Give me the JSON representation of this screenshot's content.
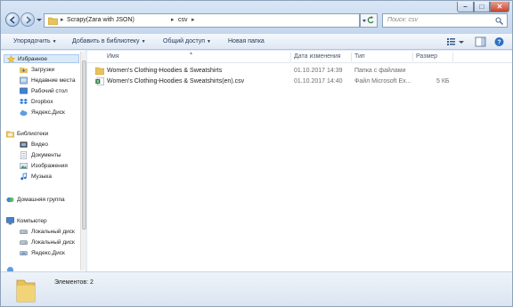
{
  "address": {
    "crumbs": [
      "Scrapy(Zara with JSON)",
      "csv"
    ],
    "search_placeholder": "Поиск: csv"
  },
  "toolbar": {
    "organize": "Упорядочить",
    "add_to_library": "Добавить в библиотеку",
    "share": "Общий доступ",
    "new_folder": "Новая папка"
  },
  "nav": {
    "favorites": "Избранное",
    "favorites_items": [
      "Загрузки",
      "Недавние места",
      "Рабочий стол",
      "Dropbox",
      "Яндекс.Диск"
    ],
    "libraries": "Библиотеки",
    "libraries_items": [
      "Видео",
      "Документы",
      "Изображения",
      "Музыка"
    ],
    "homegroup": "Домашняя группа",
    "computer": "Компьютер",
    "computer_items": [
      "Локальный диск",
      "Локальный диск",
      "Яндекс.Диск"
    ]
  },
  "columns": {
    "name": "Имя",
    "date": "Дата изменения",
    "type": "Тип",
    "size": "Размер"
  },
  "files": [
    {
      "name": "Women's Clothing-Hoodies & Sweatshirts",
      "date": "01.10.2017 14:39",
      "type": "Папка с файлами",
      "size": "",
      "kind": "folder"
    },
    {
      "name": "Women's Clothing-Hoodies & Sweatshirts(en).csv",
      "date": "01.10.2017 14:40",
      "type": "Файл Microsoft Ex...",
      "size": "5 КБ",
      "kind": "csv"
    }
  ],
  "details": {
    "count": "Элементов: 2"
  },
  "colors": {
    "window_frame": "#dfe9f5",
    "close_button": "#c9442d",
    "folder": "#e8c25a"
  }
}
